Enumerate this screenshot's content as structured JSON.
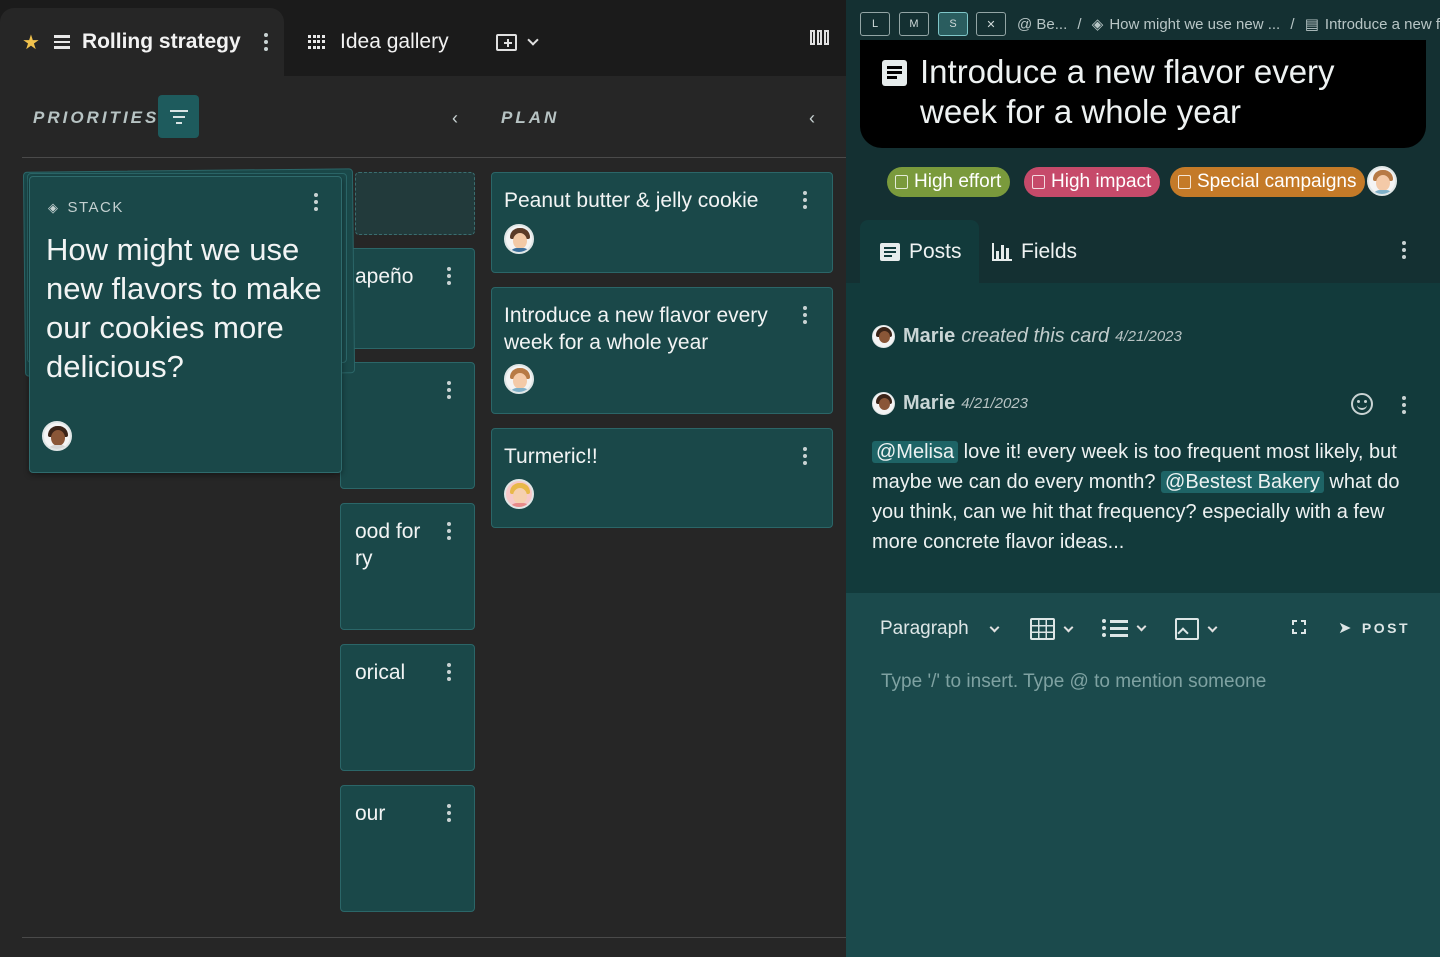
{
  "board": {
    "tabs": [
      {
        "label": "Rolling strategy",
        "active": true
      },
      {
        "label": "Idea gallery",
        "active": false
      }
    ],
    "columns": [
      {
        "title": "PRIORITIES"
      },
      {
        "title": "PLAN"
      }
    ],
    "stack_card": {
      "label": "STACK",
      "text": "How might we use new flavors to make our cookies more delicious?"
    },
    "middle_cards": [
      {
        "text": "apeño"
      },
      {
        "text": ""
      },
      {
        "text": "ood for ry"
      },
      {
        "text": "orical"
      },
      {
        "text": "our"
      }
    ],
    "plan_cards": [
      {
        "text": "Peanut butter & jelly cookie"
      },
      {
        "text": "Introduce a new flavor every week for a whole year"
      },
      {
        "text": "Turmeric!!"
      }
    ]
  },
  "panel": {
    "size_buttons": [
      "L",
      "M",
      "S",
      "✕"
    ],
    "breadcrumbs": [
      "@ Be...",
      "/",
      "How might we use new ...",
      "/",
      "Introduce a new fl..."
    ],
    "title": "Introduce a new flavor every week for a whole year",
    "tags": [
      {
        "label": "High effort",
        "color": "#7a9a3c"
      },
      {
        "label": "High impact",
        "color": "#c64a6a"
      },
      {
        "label": "Special campaigns",
        "color": "#c47a28"
      }
    ],
    "tabs": [
      {
        "label": "Posts",
        "active": true
      },
      {
        "label": "Fields",
        "active": false
      }
    ],
    "activity": {
      "author": "Marie",
      "action": "created this card",
      "date": "4/21/2023"
    },
    "post": {
      "author": "Marie",
      "date": "4/21/2023",
      "mention1": "@Melisa",
      "text1": " love it! every week is too frequent most likely, but maybe we can do every month? ",
      "mention2": "@Bestest Bakery",
      "text2": " what do you think, can we hit that frequency? especially with a few more concrete flavor ideas..."
    },
    "editor": {
      "block_type": "Paragraph",
      "placeholder": "Type '/' to insert. Type @ to mention someone",
      "post_label": "POST"
    }
  }
}
